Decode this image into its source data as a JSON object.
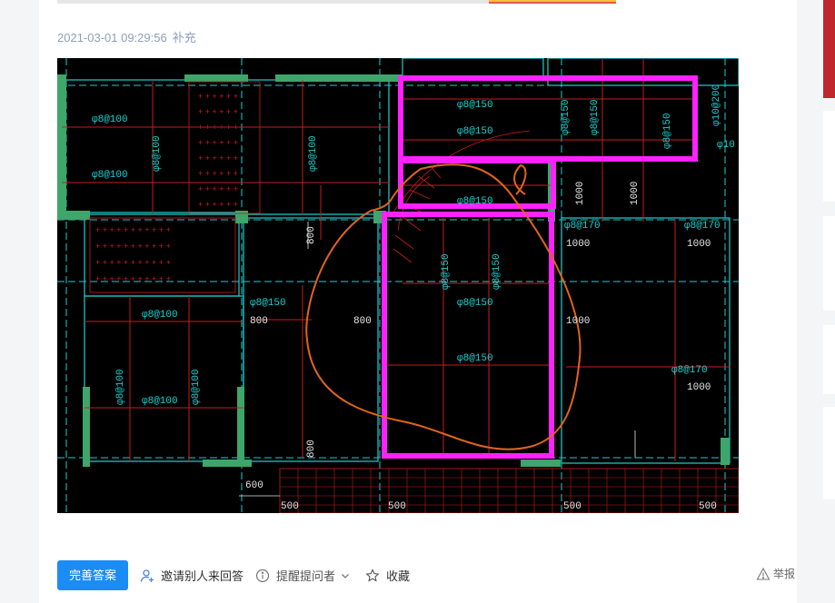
{
  "post": {
    "timestamp": "2021-03-01 09:29:56",
    "supplement_label": "补充"
  },
  "drawing": {
    "labels_phi8_100": [
      "φ8@100",
      "φ8@100",
      "φ8@100",
      "φ8@100",
      "φ8@100",
      "φ8@100",
      "φ8@100",
      "φ8@100"
    ],
    "labels_phi8_150": [
      "φ8@150",
      "φ8@150",
      "φ8@150",
      "φ8@150",
      "φ8@150",
      "φ8@150",
      "φ8@150",
      "φ8@150",
      "φ8@150",
      "φ8@150",
      "φ8@150"
    ],
    "labels_phi8_170": [
      "φ8@170",
      "φ8@170",
      "φ8@170"
    ],
    "labels_phi10": [
      "φ10@200",
      "φ10"
    ],
    "dims": [
      "1000",
      "1000",
      "1000",
      "1000",
      "1000",
      "1000",
      "800",
      "800",
      "800",
      "800",
      "600",
      "500",
      "500",
      "500",
      "500"
    ]
  },
  "actions": {
    "perfect_answer": "完善答案",
    "invite": "邀请别人来回答",
    "remind": "提醒提问者",
    "favorite": "收藏",
    "report": "举报"
  },
  "colors": {
    "primary": "#1b8cf5",
    "magenta": "#ff22ff",
    "cad_green": "#3fa56a",
    "cad_red": "#c81d1d",
    "cad_cyan": "#1ad1d1",
    "cad_orange": "#e0641c"
  }
}
